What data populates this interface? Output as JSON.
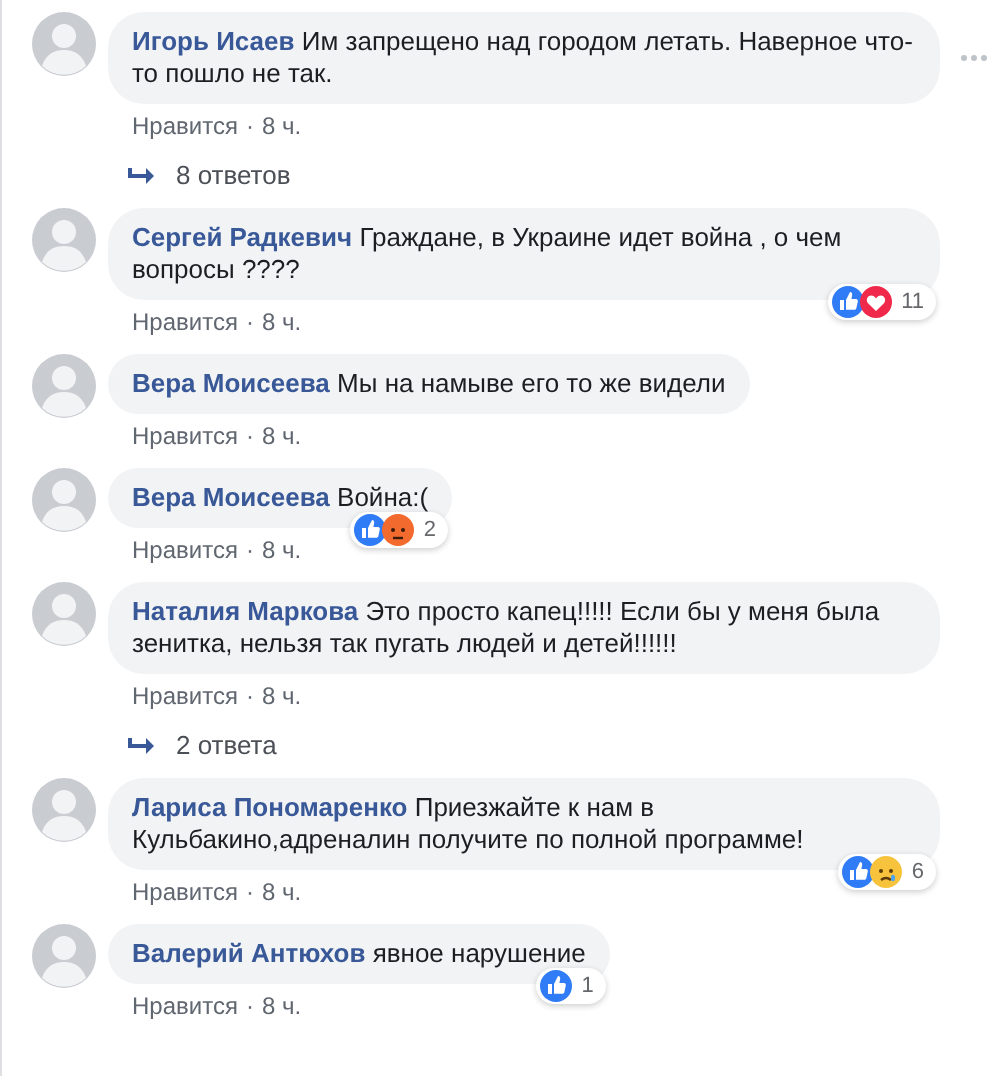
{
  "comments": [
    {
      "author": "Игорь Исаев",
      "text": "Им запрещено над городом летать. Наверное что-то пошло не так.",
      "like": "Нравится",
      "dot": "·",
      "time": "8 ч.",
      "menu": true,
      "replies": "8 ответов"
    },
    {
      "author": "Сергей Радкевич",
      "text": "Граждане, в Украине идет война , о чем вопросы ????",
      "like": "Нравится",
      "dot": "·",
      "time": "8 ч.",
      "reactions": {
        "icons": [
          {
            "kind": "like"
          },
          {
            "kind": "love"
          }
        ],
        "count": "11"
      }
    },
    {
      "author": "Вера Моисеева",
      "text": "Мы на намыве его то же видели",
      "like": "Нравится",
      "dot": "·",
      "time": "8 ч."
    },
    {
      "author": "Вера Моисеева",
      "text": "Война:(",
      "like": "Нравится",
      "dot": "·",
      "time": "8 ч.",
      "reactions": {
        "icons": [
          {
            "kind": "like"
          },
          {
            "kind": "angry"
          }
        ],
        "count": "2"
      }
    },
    {
      "author": "Наталия Маркова",
      "text": "Это просто капец!!!!! Если бы у меня была зенитка, нельзя так пугать людей и детей!!!!!!",
      "like": "Нравится",
      "dot": "·",
      "time": "8 ч.",
      "replies": "2 ответа"
    },
    {
      "author": "Лариса Пономаренко",
      "text": "Приезжайте к нам в Кульбакино,адреналин получите по полной программе!",
      "like": "Нравится",
      "dot": "·",
      "time": "8 ч.",
      "reactions": {
        "icons": [
          {
            "kind": "like"
          },
          {
            "kind": "sad"
          }
        ],
        "count": "6"
      }
    },
    {
      "author": "Валерий Антюхов",
      "text": "явное нарушение",
      "like": "Нравится",
      "dot": "·",
      "time": "8 ч.",
      "reactions": {
        "icons": [
          {
            "kind": "like"
          }
        ],
        "count": "1"
      }
    }
  ]
}
